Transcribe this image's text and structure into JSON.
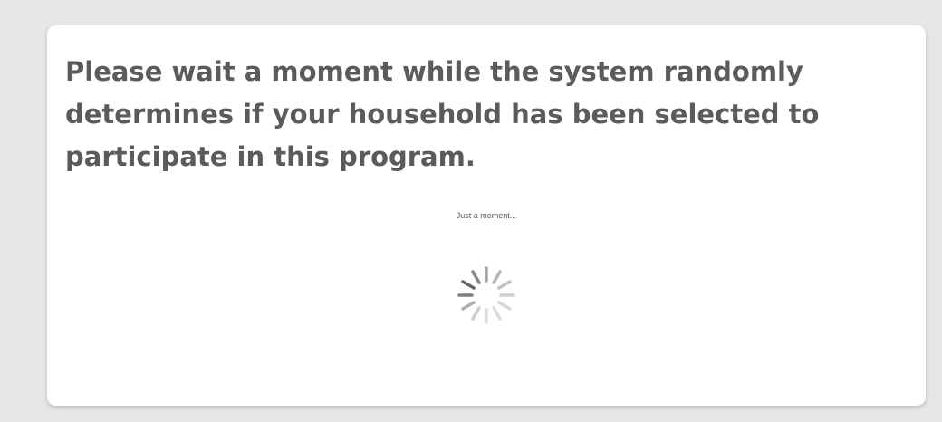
{
  "message": {
    "heading": "Please wait a moment while the system randomly determines if your household has been selected to participate in this program."
  },
  "loader": {
    "status_text": "Just a moment...",
    "icon": "spinner-icon",
    "colors": {
      "spoke": "#5f5f5f",
      "background": "#e6e6e6",
      "card": "#ffffff",
      "text": "#5b5b5b"
    }
  }
}
